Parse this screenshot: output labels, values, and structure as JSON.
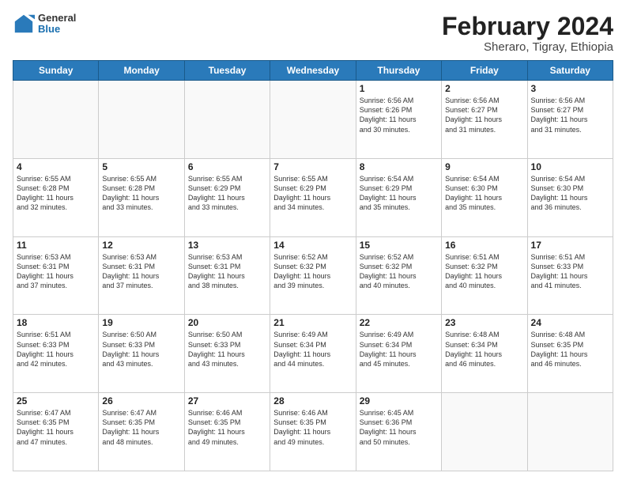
{
  "header": {
    "logo": {
      "general": "General",
      "blue": "Blue"
    },
    "title": "February 2024",
    "location": "Sheraro, Tigray, Ethiopia"
  },
  "weekdays": [
    "Sunday",
    "Monday",
    "Tuesday",
    "Wednesday",
    "Thursday",
    "Friday",
    "Saturday"
  ],
  "weeks": [
    [
      {
        "day": "",
        "info": ""
      },
      {
        "day": "",
        "info": ""
      },
      {
        "day": "",
        "info": ""
      },
      {
        "day": "",
        "info": ""
      },
      {
        "day": "1",
        "info": "Sunrise: 6:56 AM\nSunset: 6:26 PM\nDaylight: 11 hours\nand 30 minutes."
      },
      {
        "day": "2",
        "info": "Sunrise: 6:56 AM\nSunset: 6:27 PM\nDaylight: 11 hours\nand 31 minutes."
      },
      {
        "day": "3",
        "info": "Sunrise: 6:56 AM\nSunset: 6:27 PM\nDaylight: 11 hours\nand 31 minutes."
      }
    ],
    [
      {
        "day": "4",
        "info": "Sunrise: 6:55 AM\nSunset: 6:28 PM\nDaylight: 11 hours\nand 32 minutes."
      },
      {
        "day": "5",
        "info": "Sunrise: 6:55 AM\nSunset: 6:28 PM\nDaylight: 11 hours\nand 33 minutes."
      },
      {
        "day": "6",
        "info": "Sunrise: 6:55 AM\nSunset: 6:29 PM\nDaylight: 11 hours\nand 33 minutes."
      },
      {
        "day": "7",
        "info": "Sunrise: 6:55 AM\nSunset: 6:29 PM\nDaylight: 11 hours\nand 34 minutes."
      },
      {
        "day": "8",
        "info": "Sunrise: 6:54 AM\nSunset: 6:29 PM\nDaylight: 11 hours\nand 35 minutes."
      },
      {
        "day": "9",
        "info": "Sunrise: 6:54 AM\nSunset: 6:30 PM\nDaylight: 11 hours\nand 35 minutes."
      },
      {
        "day": "10",
        "info": "Sunrise: 6:54 AM\nSunset: 6:30 PM\nDaylight: 11 hours\nand 36 minutes."
      }
    ],
    [
      {
        "day": "11",
        "info": "Sunrise: 6:53 AM\nSunset: 6:31 PM\nDaylight: 11 hours\nand 37 minutes."
      },
      {
        "day": "12",
        "info": "Sunrise: 6:53 AM\nSunset: 6:31 PM\nDaylight: 11 hours\nand 37 minutes."
      },
      {
        "day": "13",
        "info": "Sunrise: 6:53 AM\nSunset: 6:31 PM\nDaylight: 11 hours\nand 38 minutes."
      },
      {
        "day": "14",
        "info": "Sunrise: 6:52 AM\nSunset: 6:32 PM\nDaylight: 11 hours\nand 39 minutes."
      },
      {
        "day": "15",
        "info": "Sunrise: 6:52 AM\nSunset: 6:32 PM\nDaylight: 11 hours\nand 40 minutes."
      },
      {
        "day": "16",
        "info": "Sunrise: 6:51 AM\nSunset: 6:32 PM\nDaylight: 11 hours\nand 40 minutes."
      },
      {
        "day": "17",
        "info": "Sunrise: 6:51 AM\nSunset: 6:33 PM\nDaylight: 11 hours\nand 41 minutes."
      }
    ],
    [
      {
        "day": "18",
        "info": "Sunrise: 6:51 AM\nSunset: 6:33 PM\nDaylight: 11 hours\nand 42 minutes."
      },
      {
        "day": "19",
        "info": "Sunrise: 6:50 AM\nSunset: 6:33 PM\nDaylight: 11 hours\nand 43 minutes."
      },
      {
        "day": "20",
        "info": "Sunrise: 6:50 AM\nSunset: 6:33 PM\nDaylight: 11 hours\nand 43 minutes."
      },
      {
        "day": "21",
        "info": "Sunrise: 6:49 AM\nSunset: 6:34 PM\nDaylight: 11 hours\nand 44 minutes."
      },
      {
        "day": "22",
        "info": "Sunrise: 6:49 AM\nSunset: 6:34 PM\nDaylight: 11 hours\nand 45 minutes."
      },
      {
        "day": "23",
        "info": "Sunrise: 6:48 AM\nSunset: 6:34 PM\nDaylight: 11 hours\nand 46 minutes."
      },
      {
        "day": "24",
        "info": "Sunrise: 6:48 AM\nSunset: 6:35 PM\nDaylight: 11 hours\nand 46 minutes."
      }
    ],
    [
      {
        "day": "25",
        "info": "Sunrise: 6:47 AM\nSunset: 6:35 PM\nDaylight: 11 hours\nand 47 minutes."
      },
      {
        "day": "26",
        "info": "Sunrise: 6:47 AM\nSunset: 6:35 PM\nDaylight: 11 hours\nand 48 minutes."
      },
      {
        "day": "27",
        "info": "Sunrise: 6:46 AM\nSunset: 6:35 PM\nDaylight: 11 hours\nand 49 minutes."
      },
      {
        "day": "28",
        "info": "Sunrise: 6:46 AM\nSunset: 6:35 PM\nDaylight: 11 hours\nand 49 minutes."
      },
      {
        "day": "29",
        "info": "Sunrise: 6:45 AM\nSunset: 6:36 PM\nDaylight: 11 hours\nand 50 minutes."
      },
      {
        "day": "",
        "info": ""
      },
      {
        "day": "",
        "info": ""
      }
    ]
  ]
}
